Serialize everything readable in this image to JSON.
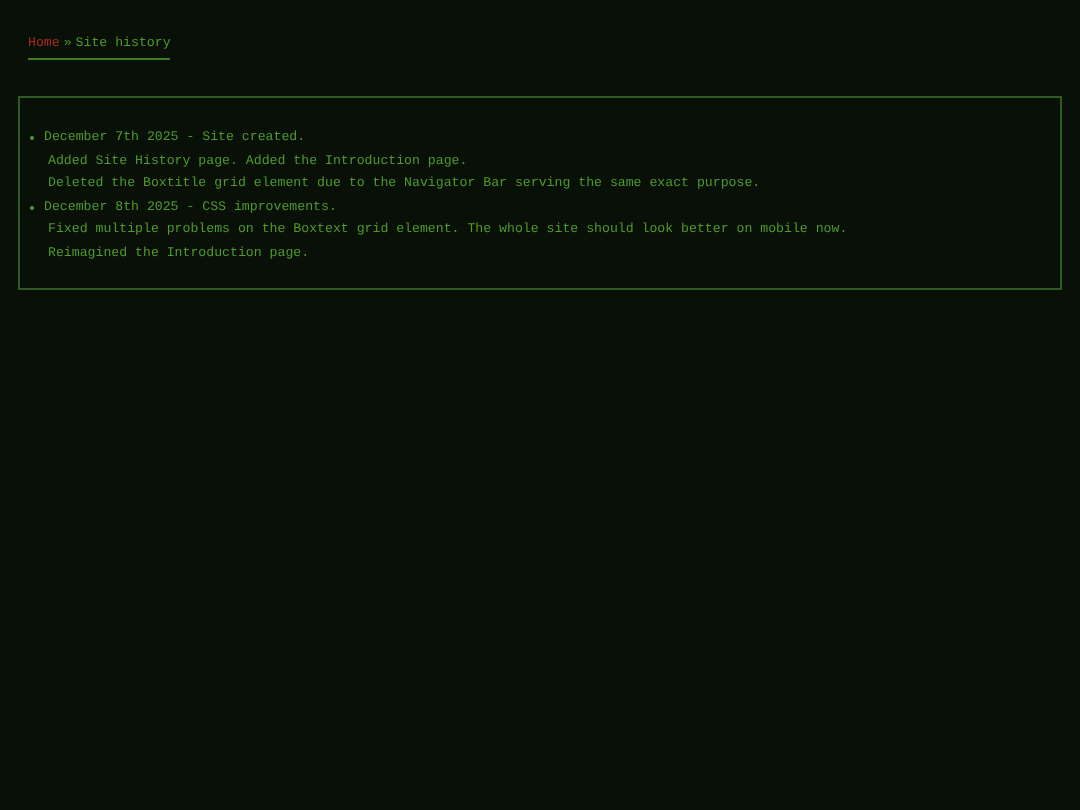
{
  "breadcrumb": {
    "home": "Home",
    "separator": "»",
    "current": "Site history"
  },
  "entries": [
    {
      "heading": "December 7th 2025 - Site created.",
      "notes": [
        "Added Site History page. Added the Introduction page.",
        "Deleted the Boxtitle grid element due to the Navigator Bar serving the same exact purpose."
      ]
    },
    {
      "heading": "December 8th 2025 - CSS improvements.",
      "notes": [
        "Fixed multiple problems on the Boxtext grid element. The whole site should look better on mobile now.",
        "Reimagined the Introduction page."
      ]
    }
  ]
}
